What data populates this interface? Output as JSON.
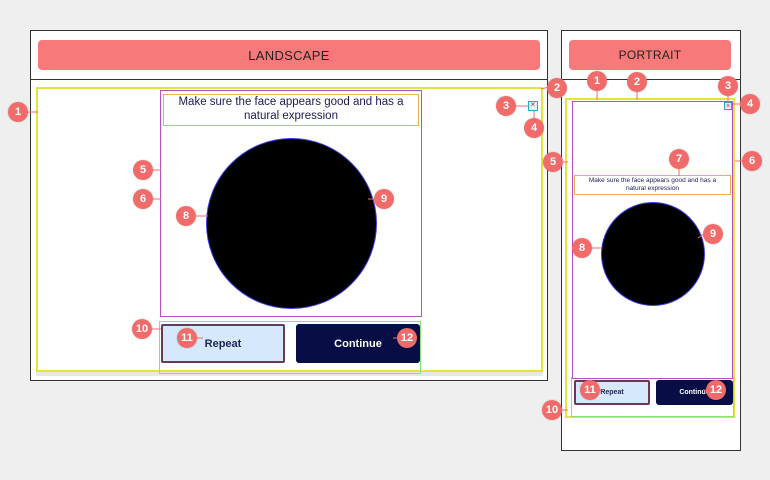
{
  "colors": {
    "banner": "#f77979",
    "badge": "#f26b6b",
    "outer_container": "#e4e43a",
    "button_container": "#8ce26e",
    "content_box": "#b54fc9",
    "instruction_border": "#e9b24a",
    "circle_border": "#3a3ae6",
    "repeat_bg": "#d6e8fb",
    "continue_bg": "#070d45"
  },
  "landscape": {
    "title": "LANDSCAPE",
    "instruction": "Make sure the face appears good and has a natural expression",
    "repeat_label": "Repeat",
    "continue_label": "Continue",
    "close_icon": "close-x-icon",
    "badges": [
      "1",
      "2",
      "3",
      "4",
      "5",
      "6",
      "8",
      "9",
      "10",
      "11",
      "12"
    ]
  },
  "portrait": {
    "title": "PORTRAIT",
    "instruction": "Make sure the face appears good and has a natural expression",
    "repeat_label": "Repeat",
    "continue_label": "Continue",
    "close_icon": "close-x-icon",
    "badges": [
      "1",
      "2",
      "3",
      "4",
      "5",
      "6",
      "7",
      "8",
      "9",
      "10",
      "11",
      "12"
    ]
  }
}
